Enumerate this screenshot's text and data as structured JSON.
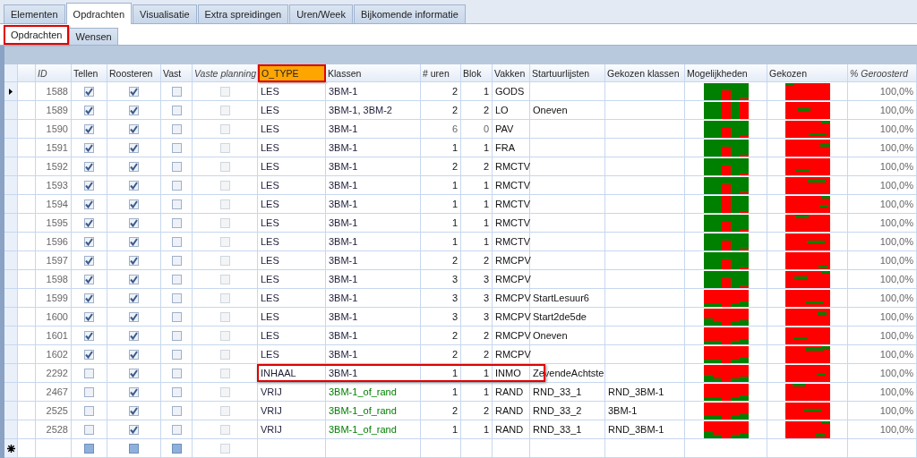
{
  "tabs": [
    {
      "label": "Elementen",
      "selected": false
    },
    {
      "label": "Opdrachten",
      "selected": true
    },
    {
      "label": "Visualisatie",
      "selected": false
    },
    {
      "label": "Extra spreidingen",
      "selected": false
    },
    {
      "label": "Uren/Week",
      "selected": false
    },
    {
      "label": "Bijkomende informatie",
      "selected": false
    }
  ],
  "subtabs": [
    {
      "label": "Opdrachten",
      "selected": true,
      "highlighted": true
    },
    {
      "label": "Wensen",
      "selected": false,
      "highlighted": false
    }
  ],
  "table": {
    "columns": [
      {
        "label": "ID",
        "italic": true,
        "highlighted": false
      },
      {
        "label": "Tellen",
        "italic": false,
        "highlighted": false
      },
      {
        "label": "Roosteren",
        "italic": false,
        "highlighted": false
      },
      {
        "label": "Vast",
        "italic": false,
        "highlighted": false
      },
      {
        "label": "Vaste planning",
        "italic": true,
        "highlighted": false,
        "disabled": true
      },
      {
        "label": "O_TYPE",
        "italic": false,
        "highlighted": true
      },
      {
        "label": "Klassen",
        "italic": false,
        "highlighted": false
      },
      {
        "label": "# uren",
        "italic": false,
        "highlighted": false
      },
      {
        "label": "Blok",
        "italic": false,
        "highlighted": false
      },
      {
        "label": "Vakken",
        "italic": false,
        "highlighted": false
      },
      {
        "label": "Startuurlijsten",
        "italic": false,
        "highlighted": false
      },
      {
        "label": "Gekozen klassen",
        "italic": false,
        "highlighted": false
      },
      {
        "label": "Mogelijkheden",
        "italic": false,
        "highlighted": false
      },
      {
        "label": "Gekozen",
        "italic": false,
        "highlighted": false
      },
      {
        "label": "% Geroosterd",
        "italic": true,
        "highlighted": false
      }
    ],
    "rows": [
      {
        "current": true,
        "id": "1588",
        "tellen": true,
        "roosteren": true,
        "vast": false,
        "vaste_planning": false,
        "o_type": "LES",
        "klassen": "3BM-1",
        "uren": "2",
        "blok": "1",
        "vakken": "GODS",
        "geroosterd": "100,0%",
        "dimmed": false,
        "highlighted": false
      },
      {
        "current": false,
        "id": "1589",
        "tellen": true,
        "roosteren": true,
        "vast": false,
        "vaste_planning": false,
        "o_type": "LES",
        "klassen": "3BM-1,  3BM-2",
        "uren": "2",
        "blok": "2",
        "vakken": "LO",
        "startuurlijsten": "Oneven",
        "geroosterd": "100,0%",
        "dimmed": false,
        "highlighted": false
      },
      {
        "current": false,
        "id": "1590",
        "tellen": true,
        "roosteren": true,
        "vast": false,
        "vaste_planning": false,
        "o_type": "LES",
        "klassen": "3BM-1",
        "uren": "6",
        "blok": "0",
        "vakken": "PAV",
        "geroosterd": "100,0%",
        "dimmed": true,
        "highlighted": false
      },
      {
        "current": false,
        "id": "1591",
        "tellen": true,
        "roosteren": true,
        "vast": false,
        "vaste_planning": false,
        "o_type": "LES",
        "klassen": "3BM-1",
        "uren": "1",
        "blok": "1",
        "vakken": "FRA",
        "geroosterd": "100,0%",
        "dimmed": false,
        "highlighted": false
      },
      {
        "current": false,
        "id": "1592",
        "tellen": true,
        "roosteren": true,
        "vast": false,
        "vaste_planning": false,
        "o_type": "LES",
        "klassen": "3BM-1",
        "uren": "2",
        "blok": "2",
        "vakken": "RMCTV",
        "geroosterd": "100,0%",
        "dimmed": false,
        "highlighted": false
      },
      {
        "current": false,
        "id": "1593",
        "tellen": true,
        "roosteren": true,
        "vast": false,
        "vaste_planning": false,
        "o_type": "LES",
        "klassen": "3BM-1",
        "uren": "1",
        "blok": "1",
        "vakken": "RMCTV",
        "geroosterd": "100,0%",
        "dimmed": false,
        "highlighted": false
      },
      {
        "current": false,
        "id": "1594",
        "tellen": true,
        "roosteren": true,
        "vast": false,
        "vaste_planning": false,
        "o_type": "LES",
        "klassen": "3BM-1",
        "uren": "1",
        "blok": "1",
        "vakken": "RMCTV",
        "geroosterd": "100,0%",
        "dimmed": false,
        "highlighted": false
      },
      {
        "current": false,
        "id": "1595",
        "tellen": true,
        "roosteren": true,
        "vast": false,
        "vaste_planning": false,
        "o_type": "LES",
        "klassen": "3BM-1",
        "uren": "1",
        "blok": "1",
        "vakken": "RMCTV",
        "geroosterd": "100,0%",
        "dimmed": false,
        "highlighted": false
      },
      {
        "current": false,
        "id": "1596",
        "tellen": true,
        "roosteren": true,
        "vast": false,
        "vaste_planning": false,
        "o_type": "LES",
        "klassen": "3BM-1",
        "uren": "1",
        "blok": "1",
        "vakken": "RMCTV",
        "geroosterd": "100,0%",
        "dimmed": false,
        "highlighted": false
      },
      {
        "current": false,
        "id": "1597",
        "tellen": true,
        "roosteren": true,
        "vast": false,
        "vaste_planning": false,
        "o_type": "LES",
        "klassen": "3BM-1",
        "uren": "2",
        "blok": "2",
        "vakken": "RMCPV",
        "geroosterd": "100,0%",
        "dimmed": false,
        "highlighted": false
      },
      {
        "current": false,
        "id": "1598",
        "tellen": true,
        "roosteren": true,
        "vast": false,
        "vaste_planning": false,
        "o_type": "LES",
        "klassen": "3BM-1",
        "uren": "3",
        "blok": "3",
        "vakken": "RMCPV",
        "geroosterd": "100,0%",
        "dimmed": false,
        "highlighted": false
      },
      {
        "current": false,
        "id": "1599",
        "tellen": true,
        "roosteren": true,
        "vast": false,
        "vaste_planning": false,
        "o_type": "LES",
        "klassen": "3BM-1",
        "uren": "3",
        "blok": "3",
        "vakken": "RMCPV",
        "startuurlijsten": "StartLesuur6",
        "geroosterd": "100,0%",
        "dimmed": false,
        "highlighted": false
      },
      {
        "current": false,
        "id": "1600",
        "tellen": true,
        "roosteren": true,
        "vast": false,
        "vaste_planning": false,
        "o_type": "LES",
        "klassen": "3BM-1",
        "uren": "3",
        "blok": "3",
        "vakken": "RMCPV",
        "startuurlijsten": "Start2de5de",
        "geroosterd": "100,0%",
        "dimmed": false,
        "highlighted": false
      },
      {
        "current": false,
        "id": "1601",
        "tellen": true,
        "roosteren": true,
        "vast": false,
        "vaste_planning": false,
        "o_type": "LES",
        "klassen": "3BM-1",
        "uren": "2",
        "blok": "2",
        "vakken": "RMCPV",
        "startuurlijsten": "Oneven",
        "geroosterd": "100,0%",
        "dimmed": false,
        "highlighted": false
      },
      {
        "current": false,
        "id": "1602",
        "tellen": true,
        "roosteren": true,
        "vast": false,
        "vaste_planning": false,
        "o_type": "LES",
        "klassen": "3BM-1",
        "uren": "2",
        "blok": "2",
        "vakken": "RMCPV",
        "geroosterd": "100,0%",
        "dimmed": false,
        "highlighted": false
      },
      {
        "current": false,
        "id": "2292",
        "tellen": false,
        "roosteren": true,
        "vast": false,
        "vaste_planning": false,
        "o_type": "INHAAL",
        "klassen": "3BM-1",
        "uren": "1",
        "blok": "1",
        "vakken": "INMO",
        "startuurlijsten": "ZevendeAchtste",
        "geroosterd": "100,0%",
        "dimmed": false,
        "highlighted": true
      },
      {
        "current": false,
        "id": "2467",
        "tellen": false,
        "roosteren": true,
        "vast": false,
        "vaste_planning": false,
        "o_type": "VRIJ",
        "klassen": "3BM-1_of_rand",
        "color": "#008000",
        "uren": "1",
        "blok": "1",
        "vakken": "RAND",
        "startuurlijsten": "RND_33_1",
        "gekozen_klassen": "RND_3BM-1",
        "geroosterd": "100,0%",
        "dimmed": false,
        "highlighted": false
      },
      {
        "current": false,
        "id": "2525",
        "tellen": false,
        "roosteren": true,
        "vast": false,
        "vaste_planning": false,
        "o_type": "VRIJ",
        "klassen": "3BM-1_of_rand",
        "color": "#008000",
        "uren": "2",
        "blok": "2",
        "vakken": "RAND",
        "startuurlijsten": "RND_33_2",
        "gekozen_klassen": "3BM-1",
        "geroosterd": "100,0%",
        "dimmed": false,
        "highlighted": false
      },
      {
        "current": false,
        "id": "2528",
        "tellen": false,
        "roosteren": true,
        "vast": false,
        "vaste_planning": false,
        "o_type": "VRIJ",
        "klassen": "3BM-1_of_rand",
        "color": "#008000",
        "uren": "1",
        "blok": "1",
        "vakken": "RAND",
        "startuurlijsten": "RND_33_1",
        "gekozen_klassen": "RND_3BM-1",
        "geroosterd": "100,0%",
        "dimmed": false,
        "highlighted": false
      }
    ],
    "new_row": {
      "indeterminate": true
    }
  }
}
